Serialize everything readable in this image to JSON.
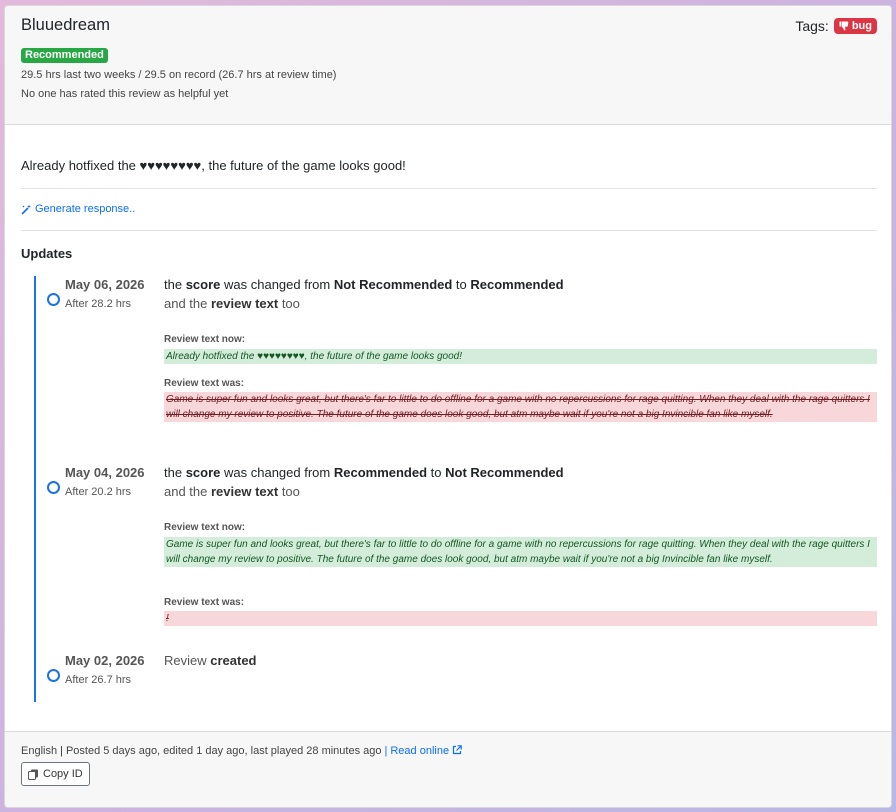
{
  "review": {
    "title": "Bluuedream",
    "tags_label": "Tags:",
    "tag": "bug",
    "badge": "Recommended",
    "hours": "29.5 hrs last two weeks / 29.5 on record (26.7 hrs at review time)",
    "helpful": "No one has rated this review as helpful yet",
    "text": "Already hotfixed the ♥♥♥♥♥♥♥♥, the future of the game looks good!",
    "generate_link": "Generate response.."
  },
  "updates": {
    "title": "Updates",
    "entries": [
      {
        "date": "May 06, 2026",
        "after": "After 28.2 hrs",
        "line_pre": "the ",
        "line_b1": "score",
        "line_mid": " was changed from ",
        "line_b2": "Not Recommended",
        "line_mid2": " to ",
        "line_b3": "Recommended",
        "sub_pre": "and the ",
        "sub_b": "review text",
        "sub_post": " too",
        "now_label": "Review text now:",
        "now_text": "Already hotfixed the ♥♥♥♥♥♥♥♥, the future of the game looks good!",
        "was_label": "Review text was:",
        "was_text": "Game is super fun and looks great, but there's far to little to do offline for a game with no repercussions for rage quitting. When they deal with the rage quitters I will change my review to positive. The future of the game does look good, but atm maybe wait if you're not a big Invincible fan like myself."
      },
      {
        "date": "May 04, 2026",
        "after": "After 20.2 hrs",
        "line_pre": "the ",
        "line_b1": "score",
        "line_mid": " was changed from ",
        "line_b2": "Recommended",
        "line_mid2": " to ",
        "line_b3": "Not Recommended",
        "sub_pre": "and the ",
        "sub_b": "review text",
        "sub_post": " too",
        "now_label": "Review text now:",
        "now_text": "Game is super fun and looks great, but there's far to little to do offline for a game with no repercussions for rage quitting. When they deal with the rage quitters I will change my review to positive. The future of the game does look good, but atm maybe wait if you're not a big Invincible fan like myself.",
        "was_label": "Review text was:",
        "was_text": "!"
      },
      {
        "date": "May 02, 2026",
        "after": "After 26.7 hrs",
        "line_pre": "Review ",
        "line_b1": "created"
      }
    ]
  },
  "footer": {
    "language": "English",
    "posted": "Posted 5 days ago, edited 1 day ago, last played 28 minutes ago",
    "read_online": "Read online",
    "copy_id": "Copy ID"
  },
  "colors": {
    "accent": "#1a73e8",
    "recommended": "#28a745",
    "bug": "#dc3545"
  }
}
